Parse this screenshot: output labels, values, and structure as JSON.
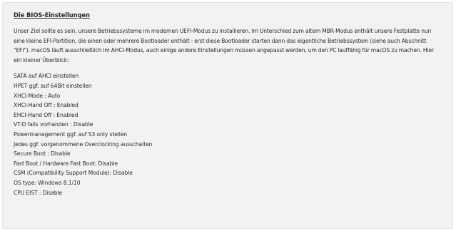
{
  "document": {
    "title": "Die BIOS-Einstellungen",
    "intro": "Unser Ziel sollte es sein, unsere Betriebssysteme im modernen UEFI-Modus zu installieren. Im Unterschied zum altem MBR-Modus enthält unsere Festplatte nun eine kleine EFI-Partition, die einen oder mehrere Bootloader enthält - erst diese Bootloader starten dann das eigentliche Betriebssystem (siehe auch Abschnitt \"EFI\"). macOS läuft ausschließlich im AHCI-Modus, auch einige andere Einstellungen müssen angepasst werden, um den PC lauffähig für macOS zu machen. Hier ein kleiner Überblick:",
    "settings": [
      "SATA auf AHCI einstellen",
      "HPET ggf. auf 64Bit einstellen",
      "XHCI-Mode : Auto",
      "XHCI-Hand Off : Enabled",
      "EHCI-Hand Off : Enabled",
      "VT-D falls vorhanden : Disable",
      "Powermanagement ggf. auf S3 only stellen",
      "Jedes ggf. vorgenommene Overclocking ausschalten",
      "Secure Boot : Disable",
      "Fast Boot / Hardware Fast Boot: Disable",
      "CSM (Compatibility Support Module): Disable",
      "OS type: Windows 8.1/10",
      "CPU EIST : Disable"
    ]
  }
}
